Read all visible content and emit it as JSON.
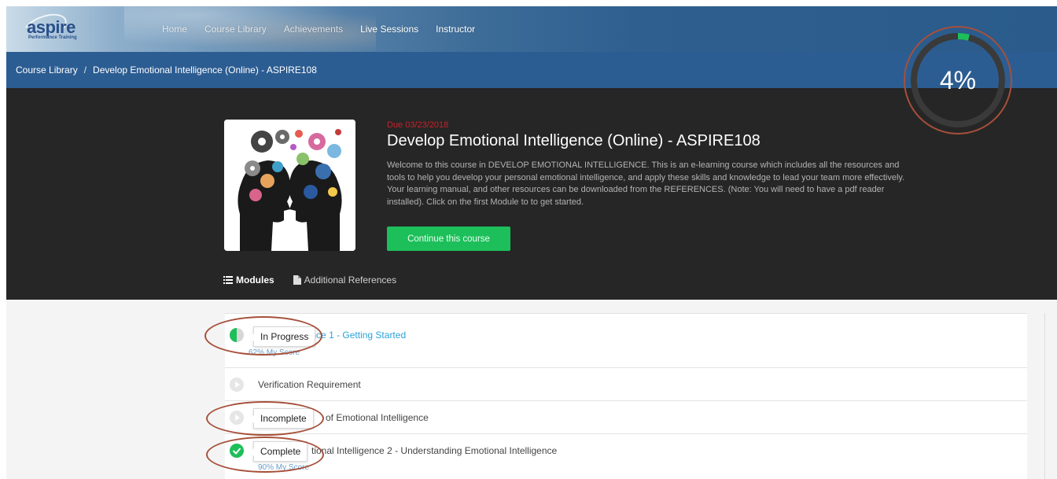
{
  "brand": {
    "name": "aspire",
    "tagline": "Performance Training"
  },
  "nav": {
    "items": [
      {
        "label": "Home"
      },
      {
        "label": "Course Library"
      },
      {
        "label": "Achievements"
      },
      {
        "label": "Live Sessions"
      },
      {
        "label": "Instructor"
      }
    ]
  },
  "breadcrumb": {
    "root": "Course Library",
    "separator": "/",
    "current": "Develop Emotional Intelligence (Online) - ASPIRE108"
  },
  "course": {
    "due": "Due 03/23/2018",
    "title": "Develop Emotional Intelligence (Online) - ASPIRE108",
    "description": "Welcome to this course in DEVELOP EMOTIONAL INTELLIGENCE. This is an e-learning course which includes all the resources and tools to help you develop your personal emotional intelligence, and apply these skills and knowledge to lead your team more effectively. Your learning manual, and other resources can be downloaded from the REFERENCES. (Note: You will need to have a pdf reader installed). Click on the first Module to to get started.",
    "continue_label": "Continue this course",
    "progress_percent": 4,
    "progress_label": "4%"
  },
  "tabs": [
    {
      "label": "Modules",
      "icon": "list-icon",
      "active": true
    },
    {
      "label": "Additional References",
      "icon": "file-icon",
      "active": false
    }
  ],
  "modules": [
    {
      "title": "Emotional Intelligence 1 - Getting Started",
      "visible_title": "onal Intelligence 1 - Getting Started",
      "score": "62% My Score",
      "status": "In Progress"
    },
    {
      "title": "Verification Requirement",
      "visible_title": "Verification Requirement",
      "score": "",
      "status": "Not started"
    },
    {
      "title": "of Emotional Intelligence",
      "visible_title": "of Emotional Intelligence",
      "score": "",
      "status": "Incomplete"
    },
    {
      "title": "Emotional Intelligence 2 - Understanding Emotional Intelligence",
      "visible_title": "tional Intelligence 2 - Understanding Emotional Intelligence",
      "score": "90% My Score",
      "status": "Complete"
    }
  ],
  "tooltips": {
    "in_progress": "In Progress",
    "incomplete": "Incomplete",
    "complete": "Complete"
  },
  "colors": {
    "nav_blue": "#2c5d92",
    "hero_bg": "#262626",
    "due_red": "#c8212a",
    "accent_green": "#1dbf5a",
    "link_blue": "#2aa3d9",
    "annotation": "#a6503a"
  }
}
